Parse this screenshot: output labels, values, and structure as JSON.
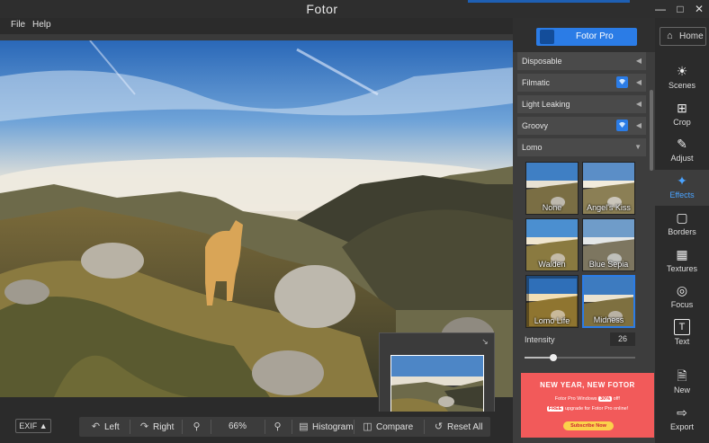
{
  "app": {
    "title": "Fotor",
    "window_controls": [
      "minimize-icon",
      "maximize-icon",
      "close-icon"
    ]
  },
  "menu": {
    "items": [
      {
        "label": "File"
      },
      {
        "label": "Help"
      }
    ]
  },
  "bottom_toolbar": {
    "exif_label": "EXIF",
    "left_label": "Left",
    "right_label": "Right",
    "zoom_value": "66%",
    "histogram_label": "Histogram",
    "compare_label": "Compare",
    "reset_label": "Reset All"
  },
  "panel": {
    "pro_button_label": "Fotor Pro",
    "categories": [
      {
        "label": "Disposable",
        "pro": false,
        "expanded": false
      },
      {
        "label": "Filmatic",
        "pro": true,
        "expanded": false
      },
      {
        "label": "Light Leaking",
        "pro": false,
        "expanded": false
      },
      {
        "label": "Groovy",
        "pro": true,
        "expanded": false
      },
      {
        "label": "Lomo",
        "pro": false,
        "expanded": true
      }
    ],
    "effects": [
      {
        "label": "None",
        "selected": false
      },
      {
        "label": "Angel's Kiss",
        "selected": false
      },
      {
        "label": "Walden",
        "selected": false
      },
      {
        "label": "Blue Sepia",
        "selected": false
      },
      {
        "label": "Lomo Life",
        "selected": false
      },
      {
        "label": "Midness",
        "selected": true
      }
    ],
    "intensity_label": "Intensity",
    "intensity_value": "26",
    "intensity_fraction": 0.26
  },
  "promo": {
    "title": "NEW YEAR, NEW FOTOR",
    "line1_prefix": "Fotor Pro Windows",
    "line1_badge": "30%",
    "line1_suffix": "off!",
    "line2_badge": "FREE",
    "line2_text": "upgrade for Fotor Pro online!",
    "button_label": "Subscribe Now"
  },
  "home": {
    "label": "Home"
  },
  "tools": [
    {
      "label": "Scenes",
      "icon": "sun-icon",
      "active": false
    },
    {
      "label": "Crop",
      "icon": "crop-icon",
      "active": false
    },
    {
      "label": "Adjust",
      "icon": "pencil-icon",
      "active": false
    },
    {
      "label": "Effects",
      "icon": "sparkle-icon",
      "active": true
    },
    {
      "label": "Borders",
      "icon": "frame-icon",
      "active": false
    },
    {
      "label": "Textures",
      "icon": "checker-icon",
      "active": false
    },
    {
      "label": "Focus",
      "icon": "target-icon",
      "active": false
    },
    {
      "label": "Text",
      "icon": "text-icon",
      "active": false
    },
    {
      "label": "New",
      "icon": "new-file-icon",
      "active": false
    },
    {
      "label": "Export",
      "icon": "export-icon",
      "active": false
    }
  ],
  "colors": {
    "accent": "#2b7ce6",
    "active_tool": "#4aa3ff",
    "promo_bg": "#f25a5a"
  }
}
